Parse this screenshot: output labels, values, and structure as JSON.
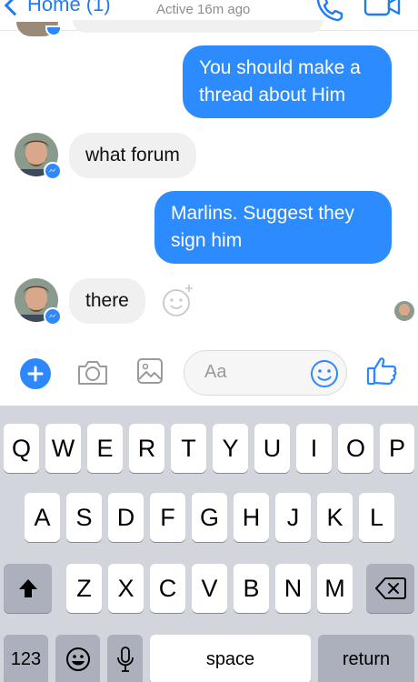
{
  "header": {
    "back_label": "Home (1)",
    "status": "Active 16m ago",
    "icons": {
      "call": "phone-icon",
      "video": "video-camera-icon"
    }
  },
  "messages": [
    {
      "direction": "outgoing",
      "text_lines": [
        "You should make a",
        "thread about Him"
      ]
    },
    {
      "direction": "incoming",
      "text_lines": [
        "what forum"
      ]
    },
    {
      "direction": "outgoing",
      "text_lines": [
        "Marlins. Suggest they",
        "sign him"
      ]
    },
    {
      "direction": "incoming",
      "text_lines": [
        "there"
      ]
    }
  ],
  "composer": {
    "placeholder": "Aa",
    "icons": [
      "plus-icon",
      "camera-icon",
      "photo-icon",
      "emoji-icon",
      "thumbs-up-icon"
    ]
  },
  "keyboard": {
    "row1": [
      "Q",
      "W",
      "E",
      "R",
      "T",
      "Y",
      "U",
      "I",
      "O",
      "P"
    ],
    "row2": [
      "A",
      "S",
      "D",
      "F",
      "G",
      "H",
      "J",
      "K",
      "L"
    ],
    "row3": [
      "Z",
      "X",
      "C",
      "V",
      "B",
      "N",
      "M"
    ],
    "numbers_label": "123",
    "space_label": "space",
    "return_label": "return"
  },
  "colors": {
    "accent": "#2c8cff",
    "incoming_bubble": "#f0f0f0",
    "keyboard_bg": "#d2d5db",
    "key_gray": "#abb0bc"
  }
}
